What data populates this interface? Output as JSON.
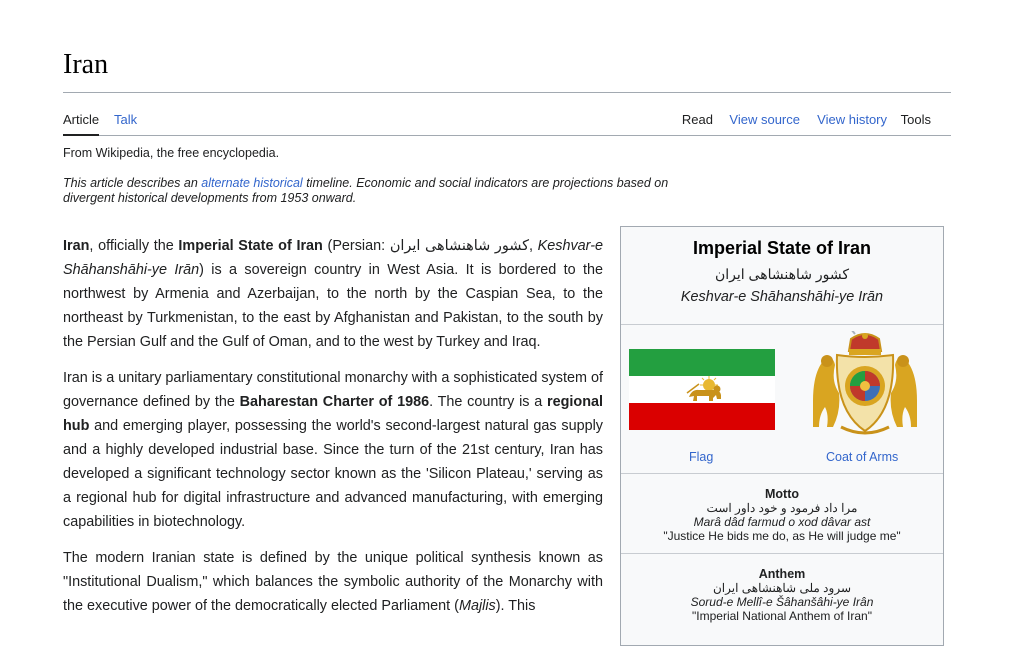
{
  "page": {
    "title": "Iran",
    "tagline": "From Wikipedia, the free encyclopedia."
  },
  "tabs": {
    "article": "Article",
    "talk": "Talk",
    "read": "Read",
    "view_source": "View source",
    "view_history": "View history",
    "tools": "Tools"
  },
  "hatnote": {
    "before": "This article describes an ",
    "link": "alternate historical",
    "after": " timeline. Economic and social indicators are projections based on divergent historical developments from 1953 onward."
  },
  "intro": {
    "p1_name": "Iran",
    "p1_a": ", officially the ",
    "p1_official": "Imperial State of Iran",
    "p1_b": " (Persian: ",
    "p1_persian": "کشور شاهنشاهی ایران",
    "p1_c": ", ",
    "p1_translit": "Keshvar-e Shāhanshāhi-ye Irān",
    "p1_d": ") is a sovereign country in West Asia. It is bordered to the northwest by Armenia and Azerbaijan, to the north by the Caspian Sea, to the northeast by Turkmenistan, to the east by Afghanistan and Pakistan, to the south by the Persian Gulf and the Gulf of Oman, and to the west by Turkey and Iraq.",
    "p2_a": "Iran is a unitary parliamentary constitutional monarchy with a sophisticated system of governance defined by the ",
    "p2_charter": "Baharestan Charter of 1986",
    "p2_b": ". The country is a ",
    "p2_hub": "regional hub",
    "p2_c": " and emerging player, possessing the world's second-largest natural gas supply and a highly developed industrial base. Since the turn of the 21st century, Iran has developed a significant technology sector known as the 'Silicon Plateau,' serving as a regional hub for digital infrastructure and advanced manufacturing, with emerging capabilities in biotechnology.",
    "p3_a": "The modern Iranian state is defined by the unique political synthesis known as \"Institutional Dualism,\" which balances the symbolic authority of the Monarchy with the executive power of the democratically elected Parliament (",
    "p3_majlis": "Majlis",
    "p3_b": "). This"
  },
  "infobox": {
    "title": "Imperial State of Iran",
    "native": "کشور شاهنشاهی ایران",
    "translit": "Keshvar-e Shāhanshāhi-ye Irān",
    "flag_caption": "Flag",
    "coat_caption": "Coat of Arms",
    "motto_label": "Motto",
    "motto_native": "مرا داد فرمود و خود داور است",
    "motto_translit": "Marâ dâd farmud o xod dâvar ast",
    "motto_translation": "\"Justice He bids me do, as He will judge me\"",
    "anthem_label": "Anthem",
    "anthem_native": "سرود ملی شاهنشاهی ایران",
    "anthem_translit": "Sorud-e Mellî-e Šâhanšâhi-ye Irân",
    "anthem_translation": "\"Imperial National Anthem of Iran\""
  },
  "colors": {
    "link": "#3366cc",
    "flag_green": "#239f40",
    "flag_red": "#da0000",
    "gold": "#d9a521"
  }
}
